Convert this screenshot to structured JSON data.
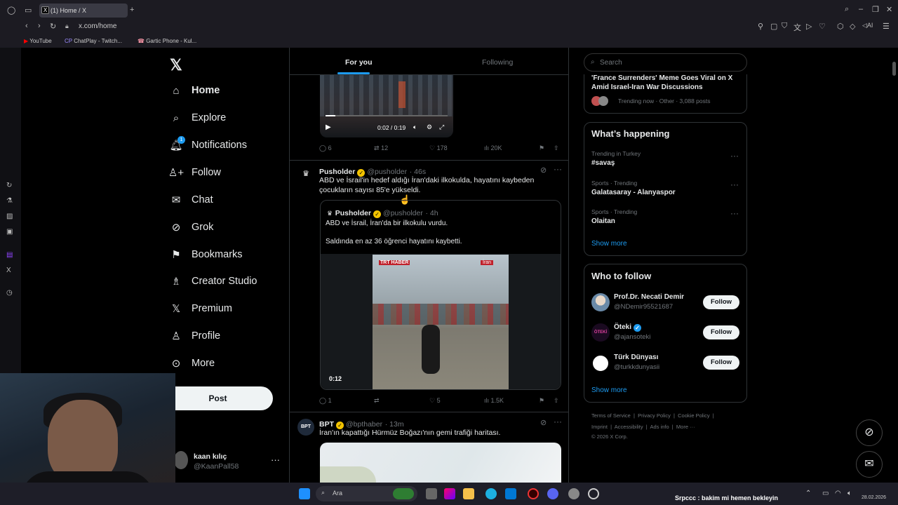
{
  "browser": {
    "tab_title": "(1) Home / X",
    "url": "x.com/home",
    "bookmarks": [
      "YouTube",
      "ChatPlay - Twitch...",
      "Gartic Phone - Kul..."
    ]
  },
  "nav": {
    "items": [
      {
        "label": "Home",
        "icon": "home-icon"
      },
      {
        "label": "Explore",
        "icon": "search-icon"
      },
      {
        "label": "Notifications",
        "icon": "bell-icon"
      },
      {
        "label": "Follow",
        "icon": "follow-icon"
      },
      {
        "label": "Chat",
        "icon": "mail-icon"
      },
      {
        "label": "Grok",
        "icon": "grok-icon"
      },
      {
        "label": "Bookmarks",
        "icon": "bookmark-icon"
      },
      {
        "label": "Creator Studio",
        "icon": "creator-icon"
      },
      {
        "label": "Premium",
        "icon": "x-icon"
      },
      {
        "label": "Profile",
        "icon": "person-icon"
      },
      {
        "label": "More",
        "icon": "more-icon"
      }
    ],
    "post_label": "Post",
    "notification_badge": "1",
    "account": {
      "name": "kaan kılıç",
      "handle": "@KaanPall58"
    }
  },
  "feed": {
    "tabs": {
      "for_you": "For you",
      "following": "Following"
    },
    "video1": {
      "time": "0:02 / 0:19"
    },
    "post1_actions": {
      "replies": "6",
      "reposts": "12",
      "likes": "178",
      "views": "20K"
    },
    "post2": {
      "name": "Pusholder",
      "handle": "@pusholder",
      "time": "· 46s",
      "text_line1": "ABD ve İsrail'in hedef aldığı İran'daki ilkokulda, hayatını kaybeden",
      "text_line2": "çocukların sayısı 85'e yükseldi.",
      "quote": {
        "name": "Pusholder",
        "handle": "@pusholder",
        "time": "· 4h",
        "line1": "ABD ve İsrail, İran'da bir ilkokulu vurdu.",
        "line2": "Saldında en az 36 öğrenci hayatını kaybetti.",
        "video_duration": "0:12",
        "logo_left": "TRT HABER",
        "logo_right": "İran"
      },
      "actions": {
        "replies": "1",
        "reposts": "",
        "likes": "5",
        "views": "1.5K"
      }
    },
    "post3": {
      "name": "BPT",
      "handle": "@bpthaber",
      "time": "· 13m",
      "text": "İran'ın kapattığı Hürmüz Boğazı'nın gemi trafiği haritası.",
      "avatar": "BPT"
    }
  },
  "right": {
    "search_placeholder": "Search",
    "news": {
      "title_line1": "'France Surrenders' Meme Goes Viral on X",
      "title_line2": "Amid Israel-Iran War Discussions",
      "meta": "Trending now · Other · 3,088 posts"
    },
    "happening": {
      "title": "What’s happening",
      "items": [
        {
          "context": "Trending in Turkey",
          "topic": "#savaş"
        },
        {
          "context": "Sports · Trending",
          "topic": "Galatasaray - Alanyaspor"
        },
        {
          "context": "Sports · Trending",
          "topic": "Olaitan"
        }
      ],
      "show_more": "Show more"
    },
    "who_to_follow": {
      "title": "Who to follow",
      "users": [
        {
          "name": "Prof.Dr. Necati Demir",
          "handle": "@NDemir95521687"
        },
        {
          "name": "Öteki",
          "handle": "@ajansoteki"
        },
        {
          "name": "Türk Dünyası",
          "handle": "@turkkdunyasii"
        }
      ],
      "follow_label": "Follow",
      "show_more": "Show more"
    },
    "footer": {
      "line1": [
        "Terms of Service",
        "Privacy Policy",
        "Cookie Policy"
      ],
      "line2": [
        "Imprint",
        "Accessibility",
        "Ads info",
        "More ···"
      ],
      "copyright": "© 2026 X Corp."
    }
  },
  "taskbar": {
    "search_label": "Ara",
    "chat_message": "Srpccc : bakim mi hemen bekleyin",
    "clock": "28.02.2026"
  },
  "colors": {
    "accent": "#1d9bf0",
    "verified": "#f4c400",
    "background": "#000000"
  }
}
